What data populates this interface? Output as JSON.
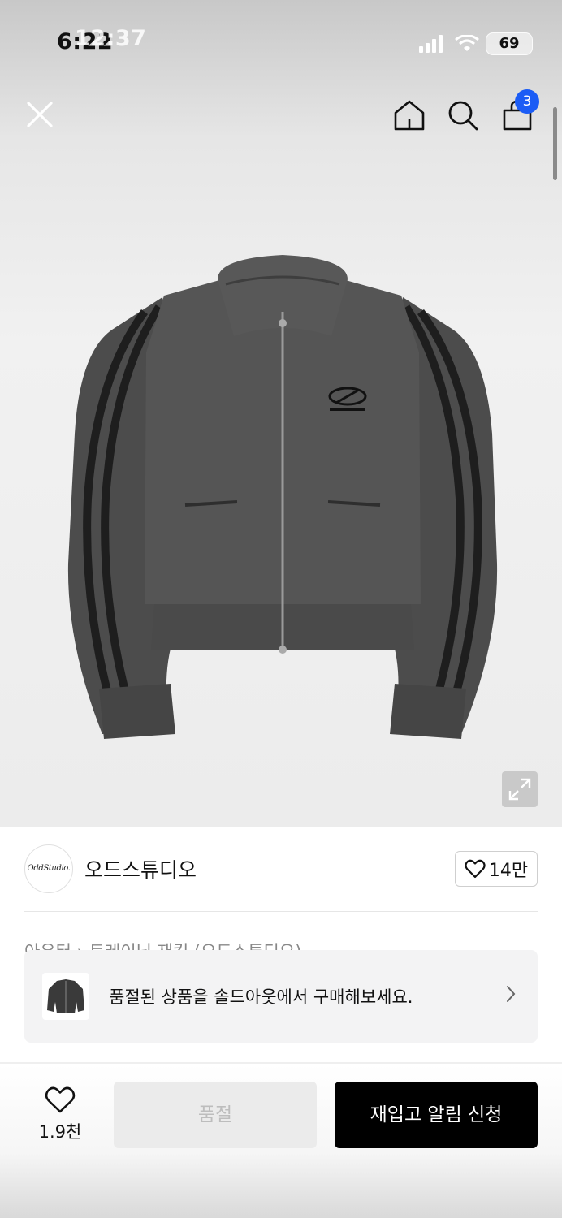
{
  "status_bar": {
    "time": "6:22",
    "time_overlay": "12:37",
    "battery": "69"
  },
  "top_nav": {
    "cart_count": "3"
  },
  "brand": {
    "logo_text": "OddStudio.",
    "name": "오드스튜디오",
    "like_count": "14만"
  },
  "breadcrumb": {
    "text": "아우터 › 트레이닝 재킷 (오드스튜디오)"
  },
  "soldout_banner": {
    "message": "품절된 상품을 솔드아웃에서 구매해보세요."
  },
  "actions": {
    "wish_count": "1.9천",
    "soldout_label": "품절",
    "restock_label": "재입고 알림 신청"
  },
  "colors": {
    "accent_badge": "#1b5cf5",
    "primary_button": "#000000",
    "disabled_button": "#ebebeb"
  },
  "icons": [
    "close-icon",
    "home-icon",
    "search-icon",
    "cart-icon",
    "expand-icon",
    "heart-icon",
    "chevron-right-icon"
  ]
}
